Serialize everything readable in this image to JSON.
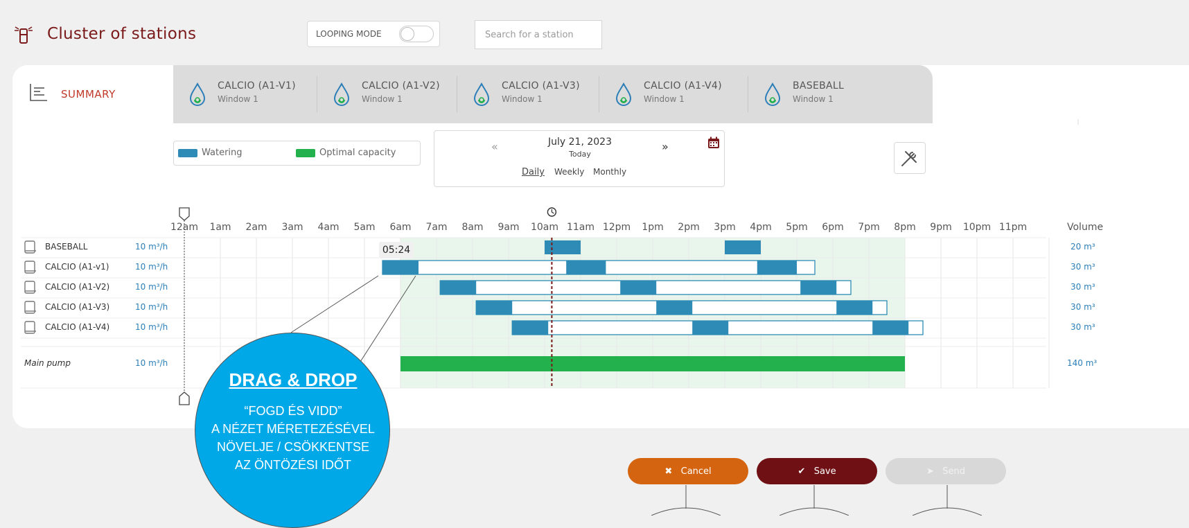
{
  "header": {
    "title": "Cluster of stations",
    "looping_label": "LOOPING MODE",
    "search_placeholder": "Search for a station"
  },
  "tabs": {
    "summary": "SUMMARY",
    "stations": [
      {
        "name": "CALCIO (A1-V1)",
        "window": "Window 1"
      },
      {
        "name": "CALCIO (A1-V2)",
        "window": "Window 1"
      },
      {
        "name": "CALCIO (A1-V3)",
        "window": "Window 1"
      },
      {
        "name": "CALCIO (A1-V4)",
        "window": "Window 1"
      },
      {
        "name": "BASEBALL",
        "window": "Window 1"
      }
    ]
  },
  "legend": {
    "watering": "Watering",
    "optimal": "Optimal capacity",
    "watering_color": "#2e8bb5",
    "optimal_color": "#22b14c"
  },
  "date": {
    "main": "July 21, 2023",
    "sub": "Today",
    "prev": "«",
    "next": "»",
    "periods": {
      "daily": "Daily",
      "weekly": "Weekly",
      "monthly": "Monthly"
    }
  },
  "schedule": {
    "hours": [
      "12am",
      "1am",
      "2am",
      "3am",
      "4am",
      "5am",
      "6am",
      "7am",
      "8am",
      "9am",
      "10am",
      "11am",
      "12pm",
      "1pm",
      "2pm",
      "3pm",
      "4pm",
      "5pm",
      "6pm",
      "7pm",
      "8pm",
      "9pm",
      "10pm",
      "11pm"
    ],
    "volume_header": "Volume",
    "drag_time": "05:24",
    "current_time_hour": 10.2,
    "optimal_window": [
      6,
      20
    ],
    "rows": [
      {
        "name": "BASEBALL",
        "flow": "10 m³/h",
        "volume": "20 m³",
        "windows": [],
        "blocks": [
          [
            10,
            11
          ],
          [
            15,
            16
          ]
        ]
      },
      {
        "name": "CALCIO (A1-v1)",
        "flow": "10 m³/h",
        "volume": "30 m³",
        "windows": [
          [
            5.5,
            17.5
          ]
        ],
        "blocks": [
          [
            5.5,
            6.5
          ],
          [
            10.6,
            11.7
          ],
          [
            15.9,
            17
          ]
        ]
      },
      {
        "name": "CALCIO (A1-V2)",
        "flow": "10 m³/h",
        "volume": "30 m³",
        "windows": [
          [
            7.1,
            18.5
          ]
        ],
        "blocks": [
          [
            7.1,
            8.1
          ],
          [
            12.1,
            13.1
          ],
          [
            17.1,
            18.1
          ]
        ]
      },
      {
        "name": "CALCIO (A1-V3)",
        "flow": "10 m³/h",
        "volume": "30 m³",
        "windows": [
          [
            8.1,
            19.5
          ]
        ],
        "blocks": [
          [
            8.1,
            9.1
          ],
          [
            13.1,
            14.1
          ],
          [
            18.1,
            19.1
          ]
        ]
      },
      {
        "name": "CALCIO (A1-V4)",
        "flow": "10 m³/h",
        "volume": "30 m³",
        "windows": [
          [
            9.1,
            20.5
          ]
        ],
        "blocks": [
          [
            9.1,
            10.1
          ],
          [
            14.1,
            15.1
          ],
          [
            19.1,
            20.1
          ]
        ]
      }
    ],
    "pump": {
      "name": "Main pump",
      "flow": "10 m³/h",
      "volume": "140 m³",
      "span": [
        6,
        20
      ]
    }
  },
  "buttons": {
    "cancel": "Cancel",
    "save": "Save",
    "send": "Send"
  },
  "bubble": {
    "title": "DRAG & DROP",
    "lines": [
      "“FOGD ÉS VIDD”",
      "A NÉZET MÉRETEZÉSÉVEL",
      "NÖVELJE / CSÖKKENTSE",
      "AZ ÖNTÖZÉSI IDŐT"
    ]
  },
  "colors": {
    "accent": "#7a1a1a",
    "cancel": "#d4640f",
    "save": "#6e1014",
    "send": "#d8d8d8",
    "bubble": "#00a8e8"
  }
}
